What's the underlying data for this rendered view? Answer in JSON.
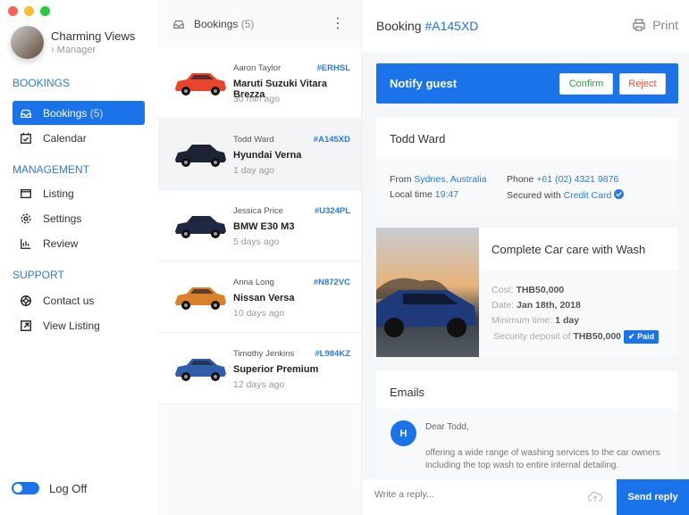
{
  "window": {
    "controls": [
      "close",
      "minimize",
      "maximize"
    ]
  },
  "profile": {
    "name": "Charming Views",
    "role": "Manager"
  },
  "sidebar": {
    "sections": [
      {
        "title": "BOOKINGS",
        "items": [
          {
            "label": "Bookings",
            "count": "(5)",
            "icon": "inbox-icon",
            "active": true
          },
          {
            "label": "Calendar",
            "icon": "calendar-icon"
          }
        ]
      },
      {
        "title": "MANAGEMENT",
        "items": [
          {
            "label": "Listing",
            "icon": "window-icon"
          },
          {
            "label": "Settings",
            "icon": "gear-icon"
          },
          {
            "label": "Review",
            "icon": "bar-chart-icon"
          }
        ]
      },
      {
        "title": "SUPPORT",
        "items": [
          {
            "label": "Contact us",
            "icon": "lifebuoy-icon"
          },
          {
            "label": "View Listing",
            "icon": "external-link-icon"
          }
        ]
      }
    ],
    "logoff": "Log Off"
  },
  "list": {
    "title": "Bookings",
    "count": "(5)",
    "items": [
      {
        "name": "Aaron Taylor",
        "id": "#ERHSL",
        "model": "Maruti Suzuki Vitara Brezza",
        "time": "30 min ago",
        "color": "#e8452a"
      },
      {
        "name": "Todd Ward",
        "id": "#A145XD",
        "model": "Hyundai Verna",
        "time": "1 day ago",
        "color": "#1c2433",
        "selected": true
      },
      {
        "name": "Jessica Price",
        "id": "#U324PL",
        "model": "BMW E30 M3",
        "time": "5 days ago",
        "color": "#1e2a45"
      },
      {
        "name": "Anna Long",
        "id": "#N872VC",
        "model": "Nissan Versa",
        "time": "10 days ago",
        "color": "#d9822b"
      },
      {
        "name": "Timothy Jenkins",
        "id": "#L984KZ",
        "model": "Superior Premium",
        "time": "12 days ago",
        "color": "#2f5fa8"
      }
    ]
  },
  "detail": {
    "title": "Booking",
    "id": "#A145XD",
    "print": "Print",
    "notify": {
      "label": "Notify guest",
      "confirm": "Confirm",
      "reject": "Reject"
    },
    "guest": {
      "name": "Todd Ward",
      "from_label": "From",
      "from": "Sydnes, Australia",
      "time_label": "Local time",
      "time": "19:47",
      "phone_label": "Phone",
      "phone": "+61 (02) 4321 9876",
      "secured_label": "Secured with",
      "secured": "Credit Card"
    },
    "service": {
      "title": "Complete Car care with Wash",
      "cost_label": "Cost:",
      "cost": "THB50,000",
      "date_label": "Date:",
      "date": "Jan 18th, 2018",
      "min_label": "Minimum time:",
      "min": "1 day",
      "deposit_label": "Security deposit of",
      "deposit": "THB50,000",
      "paid": "Paid"
    },
    "emails": {
      "title": "Emails",
      "avatar": "H",
      "greeting": "Dear Todd,",
      "body": "offering a wide range of washing services to the car owners including the top wash to entire internal detailing."
    },
    "reply": {
      "placeholder": "Write a reply...",
      "send": "Send reply"
    }
  },
  "colors": {
    "accent": "#1a73e8"
  }
}
